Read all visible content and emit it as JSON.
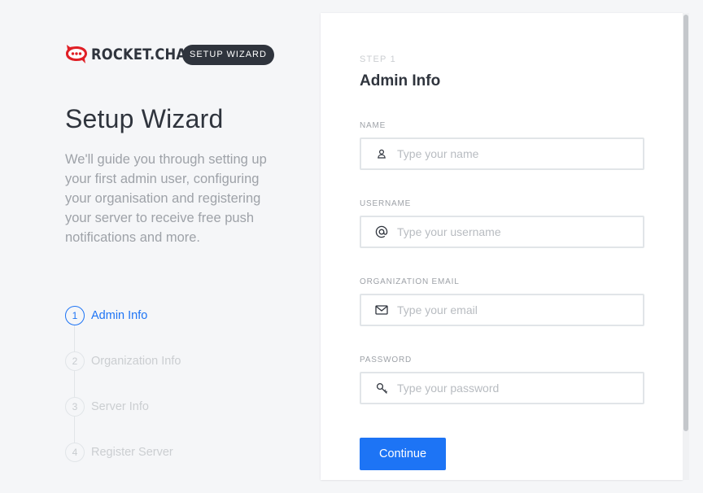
{
  "brand": {
    "logo_text": "ROCKET.CHAT",
    "badge": "SETUP WIZARD",
    "accent": "#e01f26"
  },
  "left": {
    "title": "Setup Wizard",
    "description": "We'll guide you through setting up your first admin user, configuring your organisation and registering your server to receive free push notifications and more.",
    "steps": [
      {
        "number": "1",
        "label": "Admin Info",
        "active": true
      },
      {
        "number": "2",
        "label": "Organization Info",
        "active": false
      },
      {
        "number": "3",
        "label": "Server Info",
        "active": false
      },
      {
        "number": "4",
        "label": "Register Server",
        "active": false
      }
    ]
  },
  "form": {
    "step_counter": "STEP 1",
    "title": "Admin Info",
    "fields": [
      {
        "label": "NAME",
        "placeholder": "Type your name",
        "value": "",
        "icon": "user-icon"
      },
      {
        "label": "USERNAME",
        "placeholder": "Type your username",
        "value": "",
        "icon": "at-sign-icon"
      },
      {
        "label": "ORGANIZATION EMAIL",
        "placeholder": "Type your email",
        "value": "",
        "icon": "mail-icon"
      },
      {
        "label": "PASSWORD",
        "placeholder": "Type your password",
        "value": "",
        "icon": "key-icon"
      }
    ],
    "submit_label": "Continue"
  },
  "colors": {
    "primary": "#1d74f5",
    "dark": "#2f343d",
    "muted": "#9ea2a8"
  }
}
